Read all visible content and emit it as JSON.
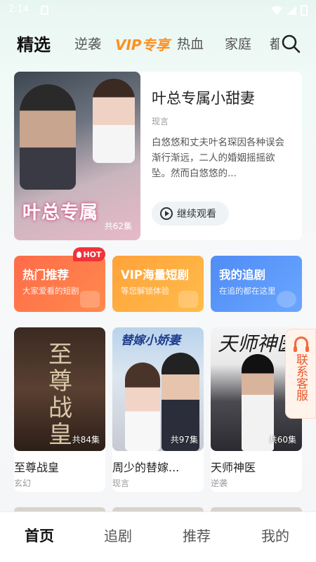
{
  "status": {
    "time": "2:14"
  },
  "tabs": [
    {
      "label": "精选",
      "active": true
    },
    {
      "label": "逆袭"
    },
    {
      "label": "VIP专享",
      "vip": true
    },
    {
      "label": "热血"
    },
    {
      "label": "家庭"
    },
    {
      "label": "都"
    }
  ],
  "featured": {
    "title": "叶总专属小甜妻",
    "genre": "现言",
    "description": "白悠悠和丈夫叶名琛因各种误会渐行渐远，二人的婚姻摇摇欲坠。然而白悠悠的...",
    "poster_title": "叶总专属",
    "episodes": "共62集",
    "continue_label": "继续观看"
  },
  "categories": [
    {
      "title": "热门推荐",
      "subtitle": "大家爱看的短剧",
      "color": "#ff6b4a"
    },
    {
      "title": "VIP海量短剧",
      "subtitle": "等您解锁体验",
      "color": "#ffa23a"
    },
    {
      "title": "我的追剧",
      "subtitle": "在追的都在这里",
      "color": "#4f8cf5"
    }
  ],
  "hot_badge": "HOT",
  "dramas": [
    {
      "title": "至尊战皇",
      "genre": "玄幻",
      "episodes": "共84集",
      "cover_text": "至尊战皇"
    },
    {
      "title": "周少的替嫁...",
      "genre": "现言",
      "episodes": "共97集",
      "cover_text": "替嫁小娇妻"
    },
    {
      "title": "天师神医",
      "genre": "逆袭",
      "episodes": "共60集",
      "cover_text": "天师神医"
    }
  ],
  "service": {
    "label": "联系客服"
  },
  "bottom_nav": [
    {
      "label": "首页",
      "active": true
    },
    {
      "label": "追剧"
    },
    {
      "label": "推荐"
    },
    {
      "label": "我的"
    }
  ],
  "colors": {
    "vip_orange": "#ff8f1f",
    "hot_red": "#f2323a",
    "service_orange": "#e8572b"
  }
}
